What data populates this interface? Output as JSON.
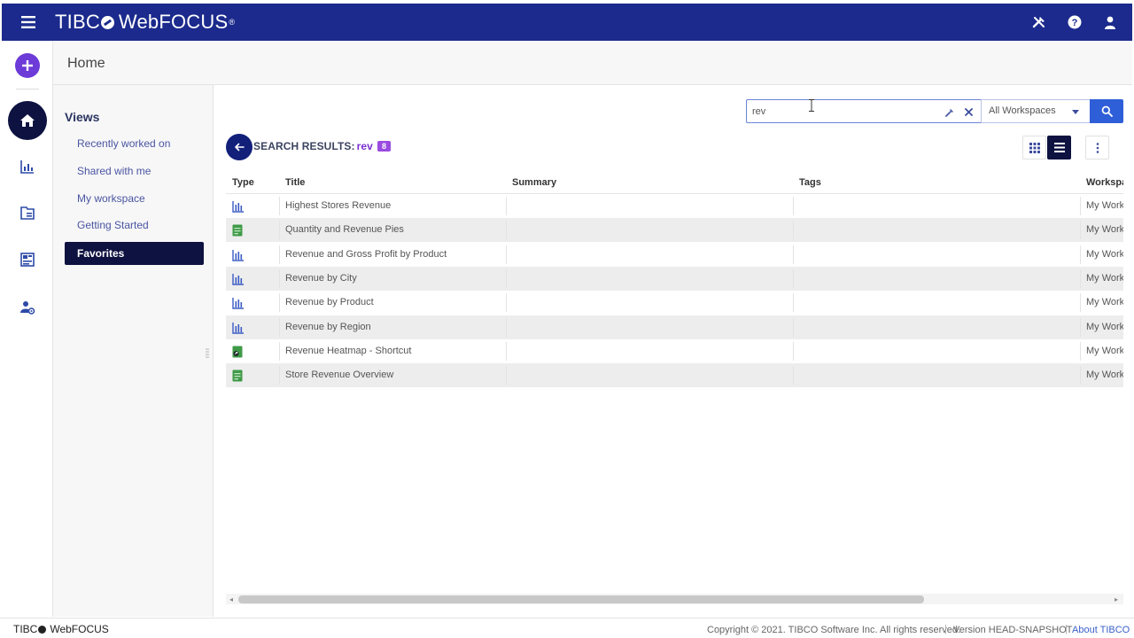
{
  "header": {
    "brand": {
      "part1": "TIBC",
      "part2": "WebFOCUS",
      "mark": "®"
    },
    "icons": [
      "tools-icon",
      "help-icon",
      "user-icon"
    ]
  },
  "rail": {
    "items": [
      "create-plus-icon",
      "home-icon",
      "reports-icon",
      "content-icon",
      "dashboard-icon",
      "admin-icon"
    ]
  },
  "page": {
    "title": "Home"
  },
  "views": {
    "title": "Views",
    "items": [
      {
        "label": "Recently worked on",
        "active": false
      },
      {
        "label": "Shared with me",
        "active": false
      },
      {
        "label": "My workspace",
        "active": false
      },
      {
        "label": "Getting Started",
        "active": false
      },
      {
        "label": "Favorites",
        "active": true
      }
    ]
  },
  "search": {
    "value": "rev",
    "scope": "All Workspaces"
  },
  "results": {
    "label": "SEARCH RESULTS:",
    "query": "rev",
    "count": "8"
  },
  "table": {
    "headers": {
      "type": "Type",
      "title": "Title",
      "summary": "Summary",
      "tags": "Tags",
      "workspace": "Workspa"
    },
    "rows": [
      {
        "type": "chart",
        "title": "Highest Stores Revenue",
        "workspace": "My Works"
      },
      {
        "type": "document",
        "title": "Quantity and Revenue Pies",
        "workspace": "My Works"
      },
      {
        "type": "chart",
        "title": "Revenue and Gross Profit by Product",
        "workspace": "My Works"
      },
      {
        "type": "chart",
        "title": "Revenue by City",
        "workspace": "My Works"
      },
      {
        "type": "chart",
        "title": "Revenue by Product",
        "workspace": "My Works"
      },
      {
        "type": "chart",
        "title": "Revenue by Region",
        "workspace": "My Works"
      },
      {
        "type": "shortcut",
        "title": "Revenue Heatmap - Shortcut",
        "workspace": "My Works"
      },
      {
        "type": "document",
        "title": "Store Revenue Overview",
        "workspace": "My Works"
      }
    ]
  },
  "footer": {
    "brand1": "TIBC",
    "brand2": "WebFOCUS",
    "copyright": "Copyright © 2021. TIBCO Software Inc. All rights reserved.",
    "version": "Version HEAD-SNAPSHOT",
    "about": "About TIBCO"
  },
  "colors": {
    "header_bg": "#1b2a8c",
    "nav_dark": "#0d1240",
    "accent_purple": "#6d3bd8",
    "search_button": "#2f5fd8",
    "count_badge": "#9a4ce0",
    "link": "#4a55a0"
  }
}
